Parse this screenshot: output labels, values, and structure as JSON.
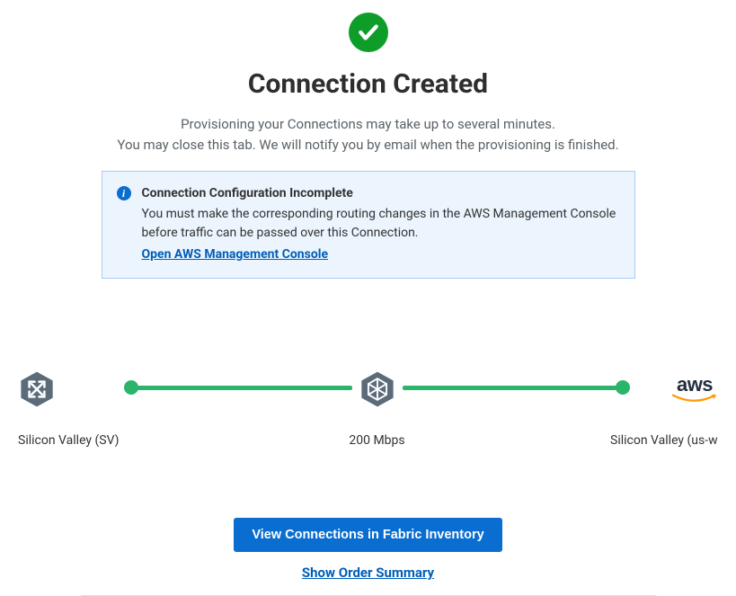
{
  "header": {
    "title": "Connection Created",
    "subtext_line1": "Provisioning your Connections may take up to several minutes.",
    "subtext_line2": "You may close this tab. We will notify you by email when the provisioning is finished."
  },
  "info": {
    "title": "Connection Configuration Incomplete",
    "body": "You must make the corresponding routing changes in the AWS Management Console before traffic can be passed over this Connection.",
    "link_label": "Open AWS Management Console"
  },
  "diagram": {
    "origin_label": "Silicon Valley (SV)",
    "speed_label": "200 Mbps",
    "destination_label": "Silicon Valley (us-wes",
    "destination_provider": "aws"
  },
  "actions": {
    "primary_label": "View Connections in Fabric Inventory",
    "secondary_label": "Show Order Summary"
  },
  "colors": {
    "success": "#0f9d2a",
    "accent": "#0a6ed1",
    "connector": "#2ab56a",
    "info_bg": "#ecf5fe",
    "info_border": "#a6cdf3"
  }
}
